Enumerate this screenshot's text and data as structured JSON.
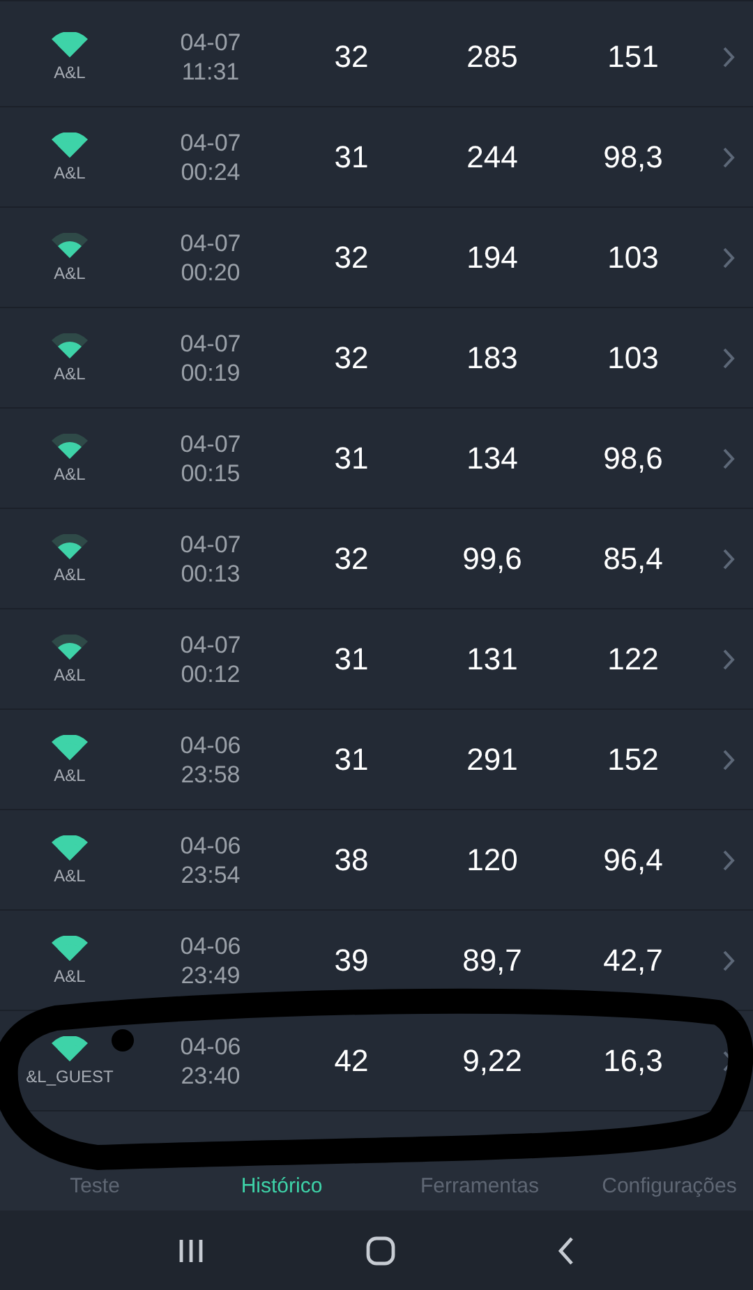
{
  "history_rows": [
    {
      "network": "A&L",
      "kind": "strong",
      "date": "04-07",
      "time": "11:31",
      "ping": "32",
      "download": "285",
      "upload": "151"
    },
    {
      "network": "A&L",
      "kind": "strong",
      "date": "04-07",
      "time": "00:24",
      "ping": "31",
      "download": "244",
      "upload": "98,3"
    },
    {
      "network": "A&L",
      "kind": "medium",
      "date": "04-07",
      "time": "00:20",
      "ping": "32",
      "download": "194",
      "upload": "103"
    },
    {
      "network": "A&L",
      "kind": "medium",
      "date": "04-07",
      "time": "00:19",
      "ping": "32",
      "download": "183",
      "upload": "103"
    },
    {
      "network": "A&L",
      "kind": "medium",
      "date": "04-07",
      "time": "00:15",
      "ping": "31",
      "download": "134",
      "upload": "98,6"
    },
    {
      "network": "A&L",
      "kind": "medium",
      "date": "04-07",
      "time": "00:13",
      "ping": "32",
      "download": "99,6",
      "upload": "85,4"
    },
    {
      "network": "A&L",
      "kind": "medium",
      "date": "04-07",
      "time": "00:12",
      "ping": "31",
      "download": "131",
      "upload": "122"
    },
    {
      "network": "A&L",
      "kind": "strong",
      "date": "04-06",
      "time": "23:58",
      "ping": "31",
      "download": "291",
      "upload": "152"
    },
    {
      "network": "A&L",
      "kind": "strong",
      "date": "04-06",
      "time": "23:54",
      "ping": "38",
      "download": "120",
      "upload": "96,4"
    },
    {
      "network": "A&L",
      "kind": "strong",
      "date": "04-06",
      "time": "23:49",
      "ping": "39",
      "download": "89,7",
      "upload": "42,7"
    },
    {
      "network": "&L_GUEST",
      "kind": "strong",
      "date": "04-06",
      "time": "23:40",
      "ping": "42",
      "download": "9,22",
      "upload": "16,3"
    }
  ],
  "bottom_nav": [
    {
      "label": "Teste",
      "selected": false
    },
    {
      "label": "Histórico",
      "selected": true
    },
    {
      "label": "Ferramentas",
      "selected": false
    },
    {
      "label": "Configurações",
      "selected": false
    }
  ]
}
